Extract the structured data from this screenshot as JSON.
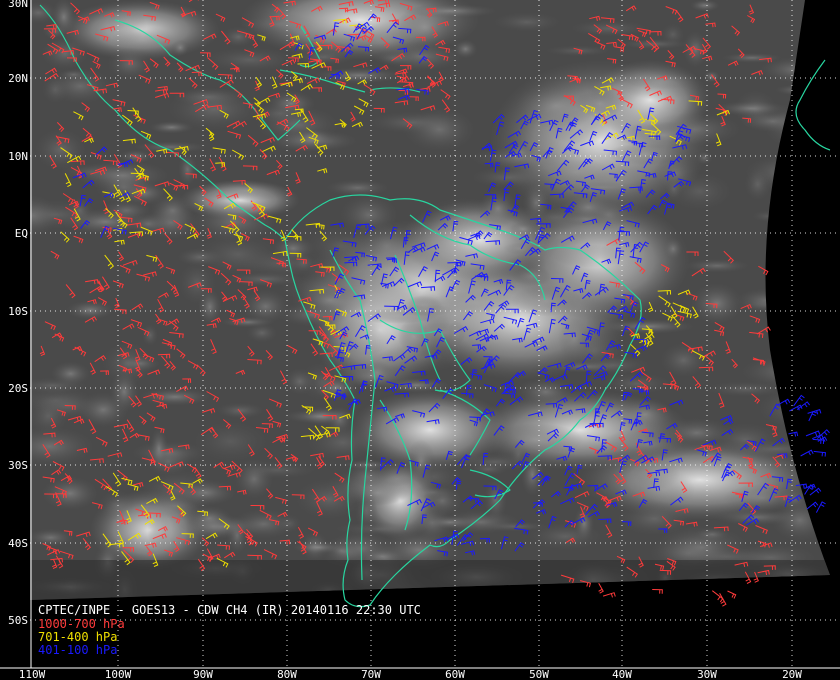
{
  "title": "CPTEC/INPE - GOES13 - CDW CH4 (IR) 20140116 22:30 UTC",
  "legend": [
    {
      "label": "1000-700 hPa",
      "color": "#ff3b3b"
    },
    {
      "label": "701-400 hPa",
      "color": "#f0e000"
    },
    {
      "label": "401-100 hPa",
      "color": "#1a1aff"
    }
  ],
  "coastline_color": "#28d6a0",
  "grid_color": "#ffffff",
  "latitude_labels": [
    "30N",
    "20N",
    "10N",
    "EQ",
    "10S",
    "20S",
    "30S",
    "40S",
    "50S"
  ],
  "longitude_labels": [
    "110W",
    "100W",
    "90W",
    "80W",
    "70W",
    "60W",
    "50W",
    "40W",
    "30W",
    "20W"
  ]
}
